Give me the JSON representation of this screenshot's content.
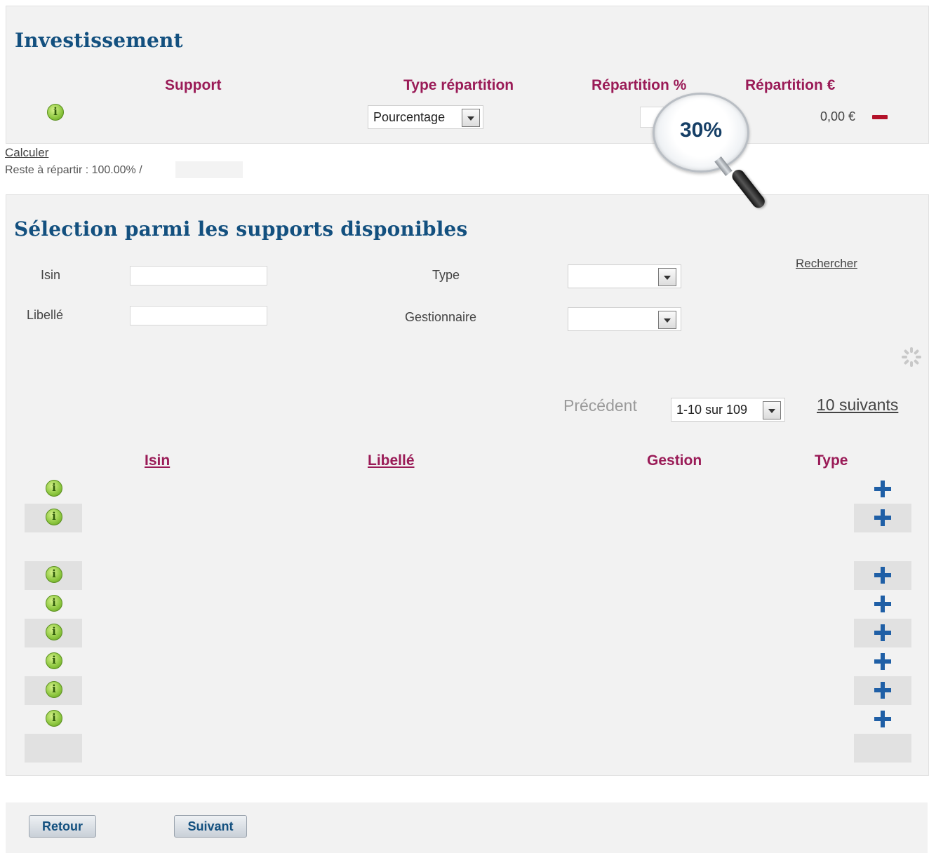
{
  "investissement": {
    "title": "Investissement",
    "columns": [
      "Support",
      "Type répartition",
      "Répartition %",
      "Répartition €"
    ],
    "row": {
      "type_repartition": "Pourcentage",
      "repartition_eur": "0,00 €"
    },
    "zoom_callout": "30%"
  },
  "calcul": {
    "link": "Calculer",
    "reste": "Reste à répartir : 100.00% /"
  },
  "selection": {
    "title": "Sélection parmi les supports disponibles",
    "filters": {
      "isin_label": "Isin",
      "libelle_label": "Libellé",
      "type_label": "Type",
      "gestionnaire_label": "Gestionnaire"
    },
    "search_link": "Rechercher",
    "pagination": {
      "previous": "Précédent",
      "range": "1-10 sur 109",
      "next": "10 suivants"
    },
    "columns": [
      "Isin",
      "Libellé",
      "Gestion",
      "Type"
    ]
  },
  "footer": {
    "back": "Retour",
    "next": "Suivant"
  },
  "icons": [
    "info-icon",
    "plus-icon",
    "minus-icon",
    "dropdown-arrow-icon",
    "spinner-icon",
    "magnifier-icon"
  ],
  "colors": {
    "title": "#13507f",
    "column_header": "#9a1b57",
    "panel": "#f2f2f2",
    "plus": "#1f5fa6",
    "minus": "#b3122a"
  }
}
